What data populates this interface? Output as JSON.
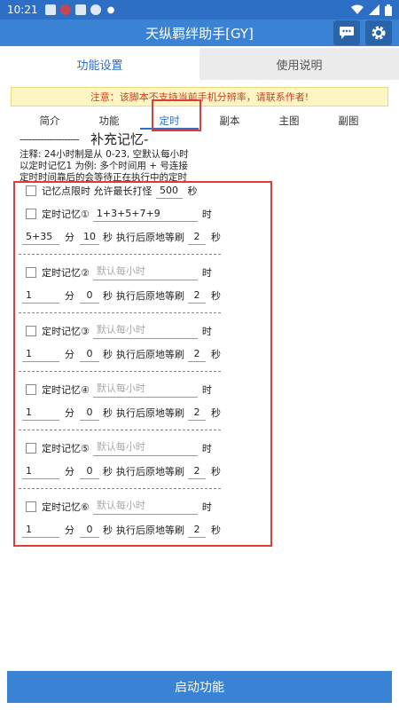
{
  "status": {
    "time": "10:21"
  },
  "app": {
    "title": "天纵羁绊助手[GY]"
  },
  "top_tabs": [
    {
      "label": "功能设置",
      "active": true
    },
    {
      "label": "使用说明",
      "active": false
    }
  ],
  "notice": "注意：该脚本不支持当前手机分辨率，请联系作者!",
  "sub_tabs": [
    {
      "label": "简介"
    },
    {
      "label": "功能"
    },
    {
      "label": "定时",
      "active": true
    },
    {
      "label": "副本"
    },
    {
      "label": "主图"
    },
    {
      "label": "副图"
    }
  ],
  "section": {
    "dashes": "--------------------",
    "title": "补充记忆",
    "dash_after": "-"
  },
  "notes": [
    "注释: 24小时制是从 0-23, 空默认每小时",
    "以定时记忆1 为例: 多个时间用 + 号连接",
    "定时时间靠后的会等待正在执行中的定时"
  ],
  "limit": {
    "label": "记忆点限时 允许最长打怪",
    "value": "500",
    "unit": "秒"
  },
  "units": {
    "hour": "时",
    "minute": "分",
    "second": "秒",
    "refresh": "执行后原地等刷"
  },
  "timers": [
    {
      "label": "定时记忆①",
      "hour_value": "1+3+5+7+9",
      "hour_placeholder": "",
      "minute": "5+35",
      "second": "10",
      "wait": "2"
    },
    {
      "label": "定时记忆②",
      "hour_value": "",
      "hour_placeholder": "默认每小时",
      "minute": "1",
      "second": "0",
      "wait": "2"
    },
    {
      "label": "定时记忆③",
      "hour_value": "",
      "hour_placeholder": "默认每小时",
      "minute": "1",
      "second": "0",
      "wait": "2"
    },
    {
      "label": "定时记忆④",
      "hour_value": "",
      "hour_placeholder": "默认每小时",
      "minute": "1",
      "second": "0",
      "wait": "2"
    },
    {
      "label": "定时记忆⑤",
      "hour_value": "",
      "hour_placeholder": "默认每小时",
      "minute": "1",
      "second": "0",
      "wait": "2"
    },
    {
      "label": "定时记忆⑥",
      "hour_value": "",
      "hour_placeholder": "默认每小时",
      "minute": "1",
      "second": "0",
      "wait": "2"
    }
  ],
  "start_button": "启动功能",
  "colors": {
    "primary": "#3a82d4",
    "status": "#2d6fc4",
    "annotation": "#e03a3a",
    "notice_bg": "#fdf6c4",
    "notice_text": "#d04020"
  }
}
